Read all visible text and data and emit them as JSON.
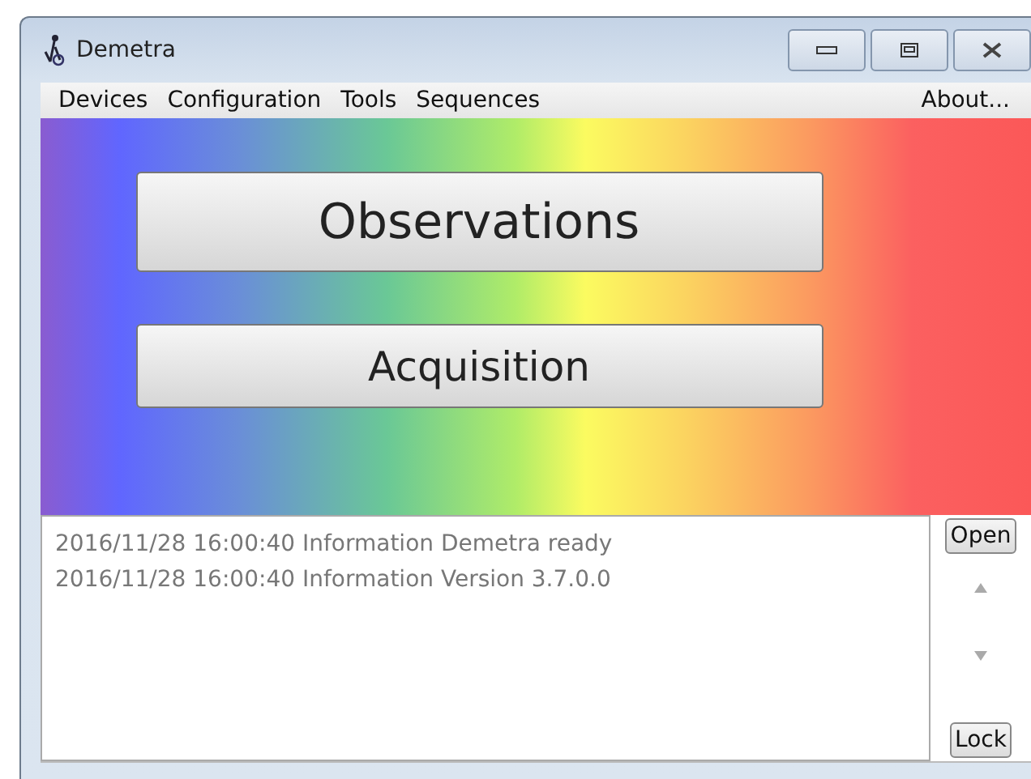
{
  "window": {
    "title": "Demetra"
  },
  "menu": {
    "items": [
      {
        "label": "Devices"
      },
      {
        "label": "Configuration"
      },
      {
        "label": "Tools"
      },
      {
        "label": "Sequences"
      }
    ],
    "about": "About..."
  },
  "buttons": [
    "Observations",
    "Acquisition"
  ],
  "log": {
    "lines": [
      "2016/11/28 16:00:40 Information Demetra ready",
      "2016/11/28 16:00:40 Information Version 3.7.0.0"
    ],
    "open_button": "Open",
    "lock_button": "Lock"
  }
}
